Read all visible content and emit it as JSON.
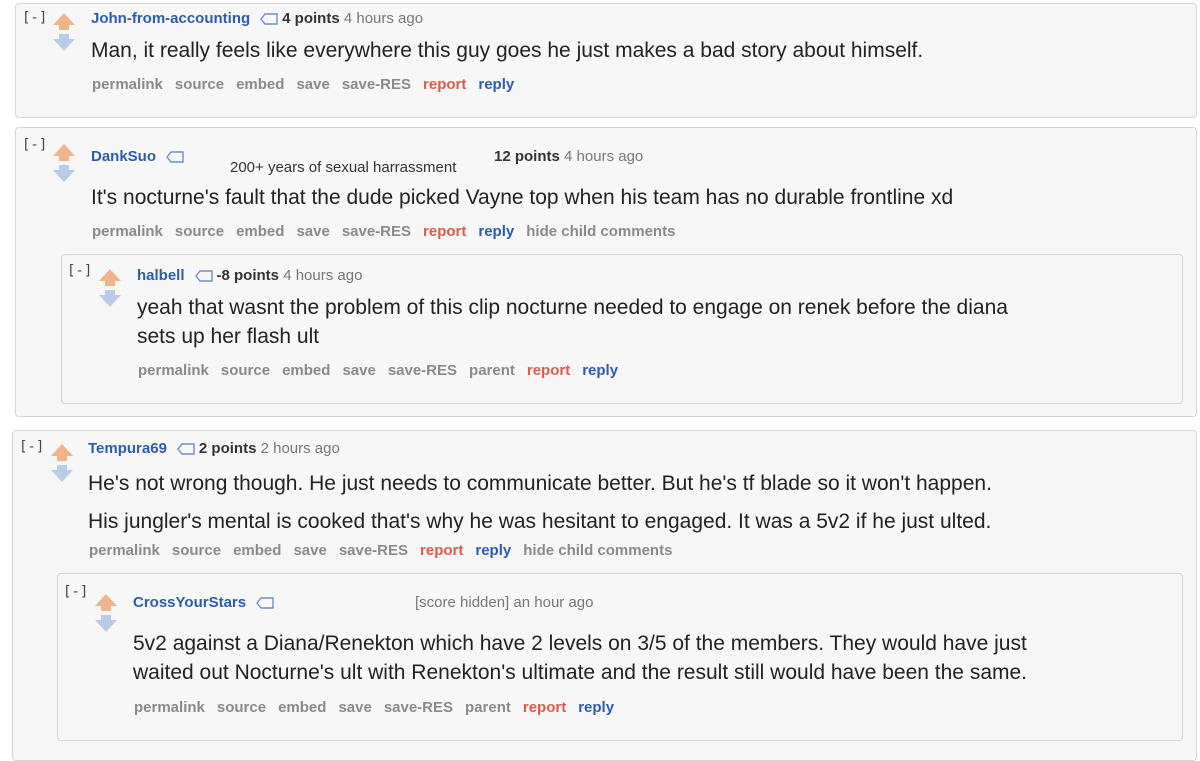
{
  "colors": {
    "author": "#2a5db0",
    "report": "#e05a4b",
    "reply": "#2a5db0",
    "action": "#8a8a8a",
    "upvote": "#f0b48a",
    "downvote": "#b8cbe8"
  },
  "comments": [
    {
      "collapse": "[-]",
      "author": "John-from-accounting",
      "score": "4 points",
      "time": "4 hours ago",
      "body": [
        "Man, it really feels like everywhere this guy goes he just makes a bad story about himself."
      ],
      "actions": {
        "permalink": "permalink",
        "source": "source",
        "embed": "embed",
        "save": "save",
        "save_res": "save-RES",
        "report": "report",
        "reply": "reply"
      }
    },
    {
      "collapse": "[-]",
      "author": "DankSuo",
      "flair": "200+ years of sexual harrassment",
      "score": "12 points",
      "time": "4 hours ago",
      "body": [
        "It's nocturne's fault that the dude picked Vayne top when his team has no durable frontline xd"
      ],
      "actions": {
        "permalink": "permalink",
        "source": "source",
        "embed": "embed",
        "save": "save",
        "save_res": "save-RES",
        "report": "report",
        "reply": "reply",
        "hide": "hide child comments"
      },
      "child": {
        "collapse": "[-]",
        "author": "halbell",
        "score": "-8 points",
        "time": "4 hours ago",
        "body": [
          "yeah that wasnt the problem of this clip nocturne needed to engage on renek before the diana",
          "sets up her flash ult"
        ],
        "actions": {
          "permalink": "permalink",
          "source": "source",
          "embed": "embed",
          "save": "save",
          "save_res": "save-RES",
          "parent": "parent",
          "report": "report",
          "reply": "reply"
        }
      }
    },
    {
      "collapse": "[-]",
      "author": "Tempura69",
      "score": "2 points",
      "time": "2 hours ago",
      "body": [
        "He's not wrong though. He just needs to communicate better. But he's tf blade so it won't happen.",
        "His jungler's mental is cooked that's why he was hesitant to engaged. It was a 5v2 if he just ulted."
      ],
      "actions": {
        "permalink": "permalink",
        "source": "source",
        "embed": "embed",
        "save": "save",
        "save_res": "save-RES",
        "report": "report",
        "reply": "reply",
        "hide": "hide child comments"
      },
      "child": {
        "collapse": "[-]",
        "author": "CrossYourStars",
        "score": "[score hidden]",
        "time": "an hour ago",
        "body": [
          "5v2 against a Diana/Renekton which have 2 levels on 3/5 of the members. They would have just",
          "waited out Nocturne's ult with Renekton's ultimate and the result still would have been the same."
        ],
        "actions": {
          "permalink": "permalink",
          "source": "source",
          "embed": "embed",
          "save": "save",
          "save_res": "save-RES",
          "parent": "parent",
          "report": "report",
          "reply": "reply"
        }
      }
    }
  ]
}
